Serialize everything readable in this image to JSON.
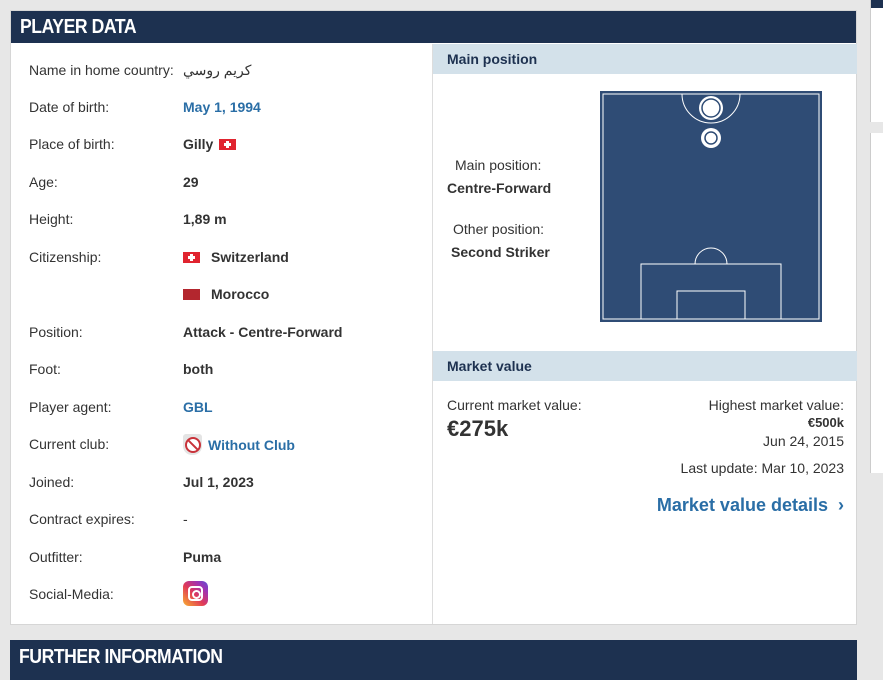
{
  "section_title": "PLAYER DATA",
  "further_title": "FURTHER INFORMATION",
  "rows": [
    {
      "label": "Name in home country:",
      "value": "كريم روسي"
    },
    {
      "label": "Date of birth:",
      "value": "May 1, 1994"
    },
    {
      "label": "Place of birth:",
      "value": "Gilly"
    },
    {
      "label": "Age:",
      "value": "29"
    },
    {
      "label": "Height:",
      "value": "1,89 m"
    },
    {
      "label": "Citizenship:",
      "value": "Switzerland"
    },
    {
      "label": "",
      "value": "Morocco"
    },
    {
      "label": "Position:",
      "value": "Attack - Centre-Forward"
    },
    {
      "label": "Foot:",
      "value": "both"
    },
    {
      "label": "Player agent:",
      "value": "GBL"
    },
    {
      "label": "Current club:",
      "value": "Without Club"
    },
    {
      "label": "Joined:",
      "value": "Jul 1, 2023"
    },
    {
      "label": "Contract expires:",
      "value": "-"
    },
    {
      "label": "Outfitter:",
      "value": "Puma"
    },
    {
      "label": "Social-Media:",
      "value": ""
    }
  ],
  "icons": {
    "place_flag": "switzerland-flag-icon",
    "cit_flag_1": "switzerland-flag-icon",
    "cit_flag_2": "morocco-flag-icon",
    "club": "no-club-icon",
    "social": "instagram-icon"
  },
  "position": {
    "title": "Main position",
    "main_label": "Main position:",
    "main_value": "Centre-Forward",
    "other_label": "Other position:",
    "other_value": "Second Striker"
  },
  "market": {
    "title": "Market value",
    "current_label": "Current market value:",
    "current_value": "€275k",
    "highest_label": "Highest market value:",
    "highest_value": "€500k",
    "highest_date": "Jun 24, 2015",
    "last_update": "Last update: Mar 10, 2023",
    "details_link": "Market value details"
  },
  "colors": {
    "header": "#1d3150",
    "subheader": "#d3e1ea",
    "link": "#2a6ea6",
    "pitch": "#2f4c75"
  }
}
